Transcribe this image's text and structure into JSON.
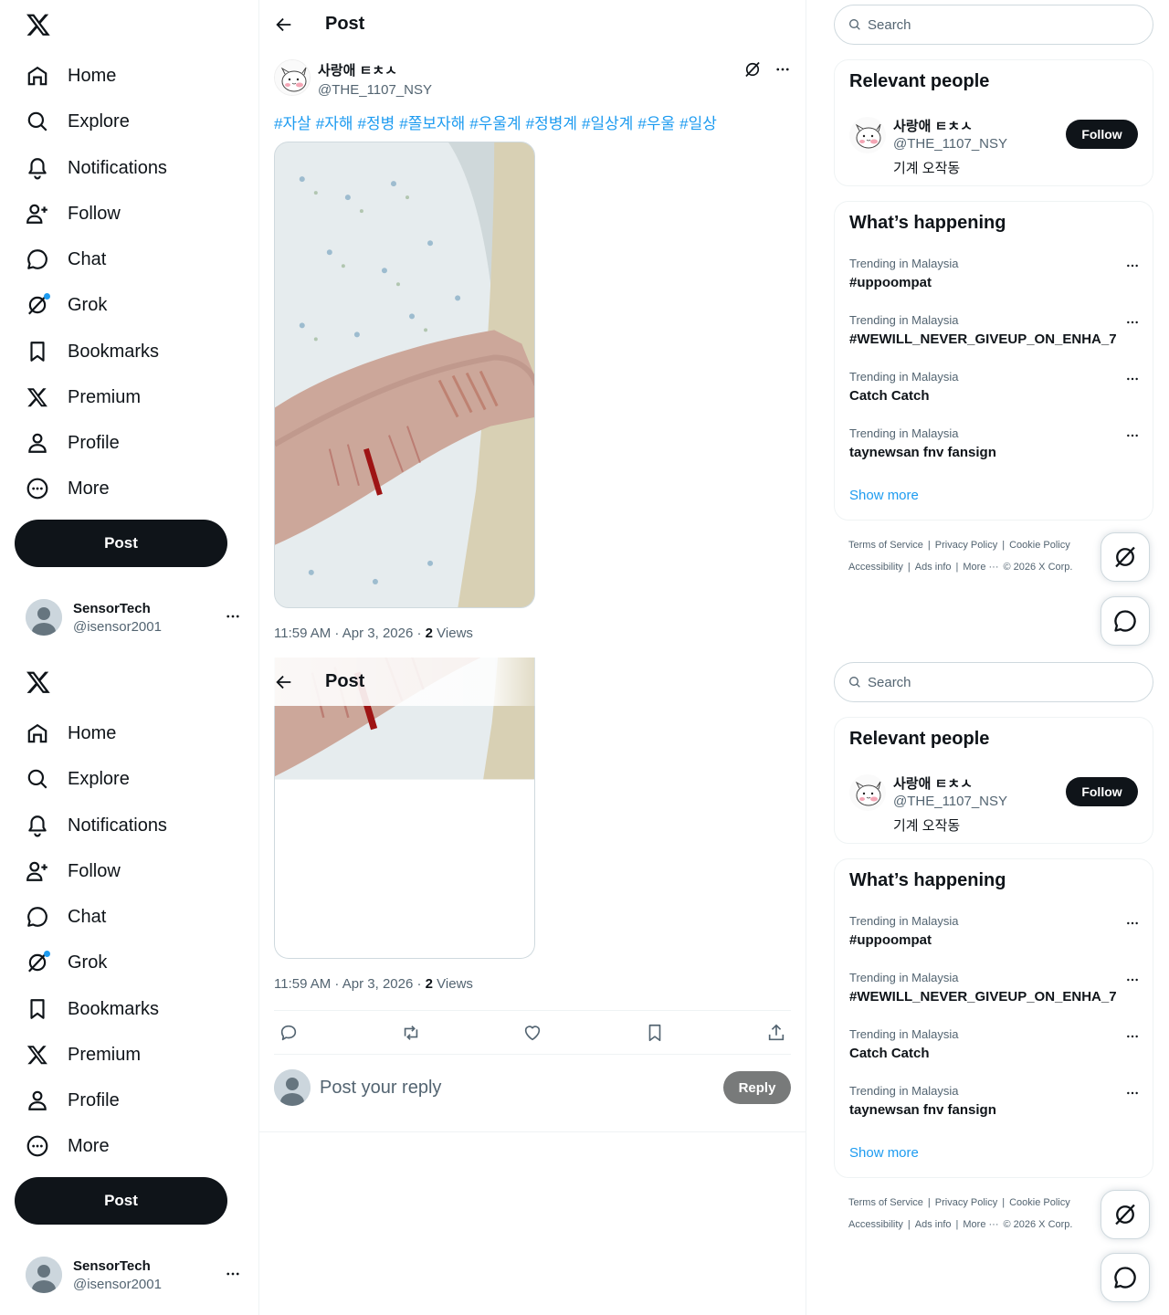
{
  "nav": {
    "items": [
      {
        "label": "Home",
        "icon": "home-icon"
      },
      {
        "label": "Explore",
        "icon": "search-icon"
      },
      {
        "label": "Notifications",
        "icon": "bell-icon"
      },
      {
        "label": "Follow",
        "icon": "person-add-icon"
      },
      {
        "label": "Chat",
        "icon": "chat-icon"
      },
      {
        "label": "Grok",
        "icon": "grok-icon"
      },
      {
        "label": "Bookmarks",
        "icon": "bookmark-icon"
      },
      {
        "label": "Premium",
        "icon": "x-logo-icon"
      },
      {
        "label": "Profile",
        "icon": "person-icon"
      },
      {
        "label": "More",
        "icon": "more-circle-icon"
      }
    ],
    "post_button": "Post"
  },
  "account": {
    "name": "SensorTech",
    "handle": "@isensor2001"
  },
  "header": {
    "title": "Post"
  },
  "post": {
    "author_name": "사랑애 ㅌㅊㅅ",
    "author_handle": "@THE_1107_NSY",
    "hashtags": [
      "#자살",
      "#자해",
      "#정병",
      "#쫄보자해",
      "#우울계",
      "#정병계",
      "#일상계",
      "#우울",
      "#일상"
    ],
    "time": "11:59 AM · Apr 3, 2026 · ",
    "views_count": "2",
    "views_label": " Views"
  },
  "reply": {
    "placeholder": "Post your reply",
    "button": "Reply"
  },
  "search": {
    "placeholder": "Search"
  },
  "relevant": {
    "title": "Relevant people",
    "name": "사랑애 ㅌㅊㅅ",
    "handle": "@THE_1107_NSY",
    "bio": "기계 오작동",
    "follow": "Follow"
  },
  "happening": {
    "title": "What’s happening",
    "trends": [
      {
        "context": "Trending in Malaysia",
        "topic": "#uppoompat"
      },
      {
        "context": "Trending in Malaysia",
        "topic": "#WEWILL_NEVER_GIVEUP_ON_ENHA_7"
      },
      {
        "context": "Trending in Malaysia",
        "topic": "Catch Catch"
      },
      {
        "context": "Trending in Malaysia",
        "topic": "taynewsan fnv fansign"
      }
    ],
    "show_more": "Show more"
  },
  "footer": {
    "links": [
      "Terms of Service",
      "|",
      "Privacy Policy",
      "|",
      "Cookie Policy"
    ],
    "links2": [
      "Accessibility",
      "|",
      "Ads info",
      "|",
      "More ···"
    ],
    "copyright": "© 2026 X Corp."
  },
  "colors": {
    "accent": "#1d9bf0",
    "text": "#0f1419",
    "muted": "#536471",
    "border": "#eff3f4"
  }
}
